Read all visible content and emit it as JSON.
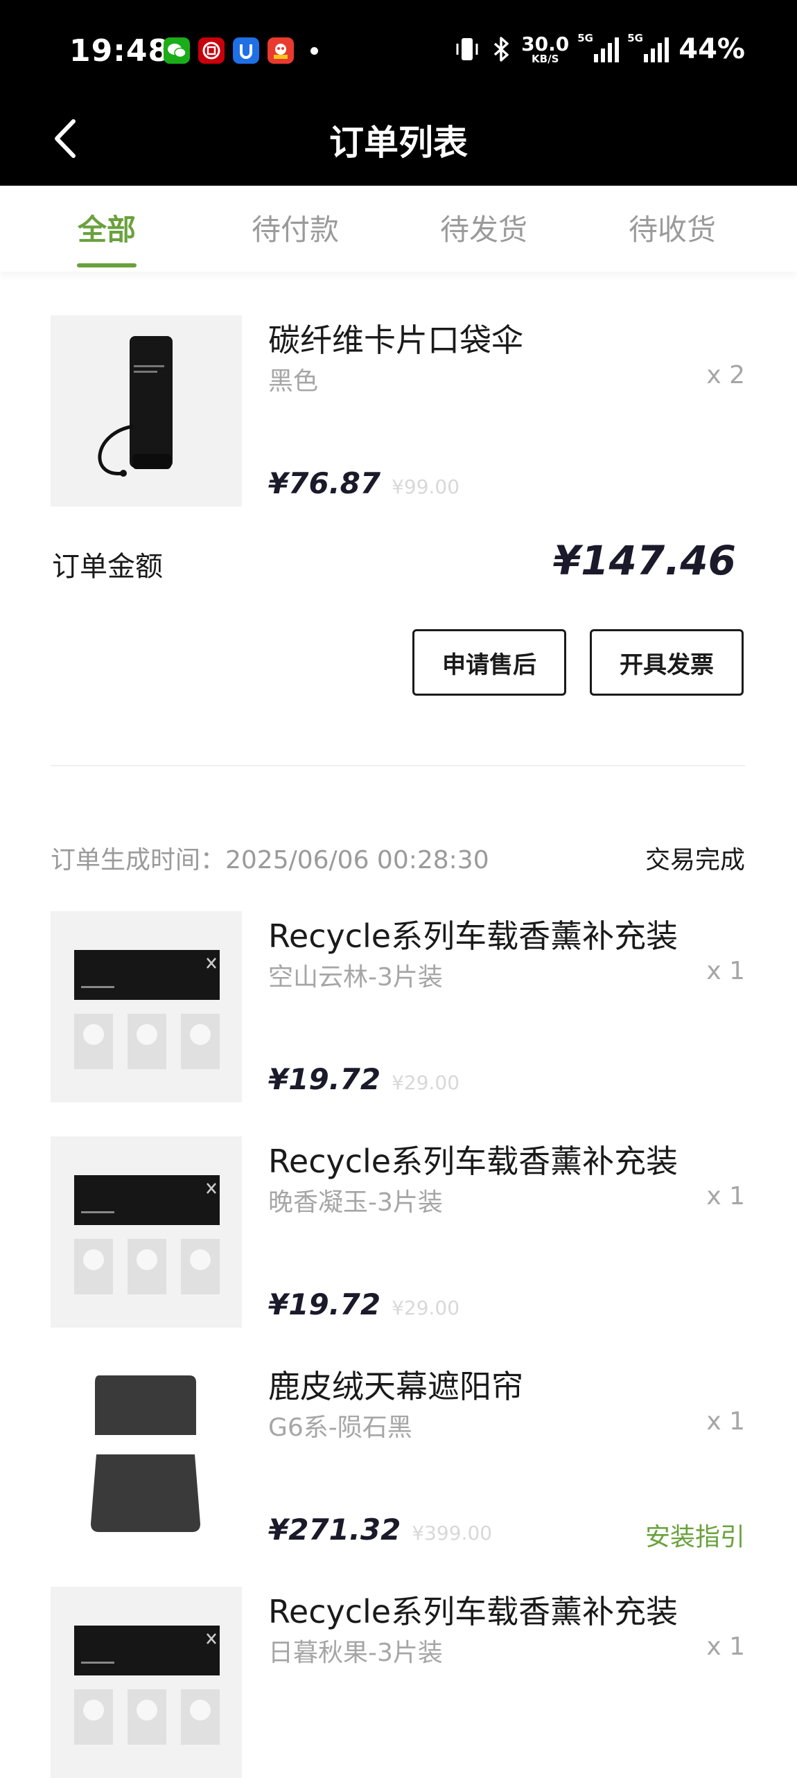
{
  "status_bar": {
    "time": "19:48",
    "net_speed_value": "30.0",
    "net_speed_unit": "KB/S",
    "signal_tag_1": "5G",
    "signal_tag_2": "5G",
    "battery": "44%",
    "apps": [
      "wechat-icon",
      "icbc-icon",
      "app-blue-icon",
      "app-red-icon"
    ]
  },
  "header": {
    "title": "订单列表"
  },
  "tabs": [
    {
      "label": "全部",
      "active": true
    },
    {
      "label": "待付款"
    },
    {
      "label": "待发货"
    },
    {
      "label": "待收货"
    }
  ],
  "order1": {
    "items": [
      {
        "name": "碳纤维卡片口袋伞",
        "spec": "黑色",
        "qty": "x 2",
        "price": "¥76.87",
        "orig_price": "¥99.00"
      }
    ],
    "total_label": "订单金额",
    "total_value": "¥147.46",
    "actions": {
      "after_sales": "申请售后",
      "invoice": "开具发票"
    }
  },
  "order2": {
    "time_label": "订单生成时间：2025/06/06 00:28:30",
    "status": "交易完成",
    "items": [
      {
        "name": "Recycle系列车载香薰补充装",
        "spec": "空山云林-3片装",
        "qty": "x 1",
        "price": "¥19.72",
        "orig_price": "¥29.00"
      },
      {
        "name": "Recycle系列车载香薰补充装",
        "spec": "晚香凝玉-3片装",
        "qty": "x 1",
        "price": "¥19.72",
        "orig_price": "¥29.00"
      },
      {
        "name": "鹿皮绒天幕遮阳帘",
        "spec": "G6系-陨石黑",
        "qty": "x 1",
        "price": "¥271.32",
        "orig_price": "¥399.00",
        "link": "安装指引"
      },
      {
        "name": "Recycle系列车载香薰补充装",
        "spec": "日暮秋果-3片装",
        "qty": "x 1"
      }
    ]
  },
  "colors": {
    "accent": "#6aa13d",
    "header_bg": "#000000",
    "muted": "#a6a6a6"
  }
}
